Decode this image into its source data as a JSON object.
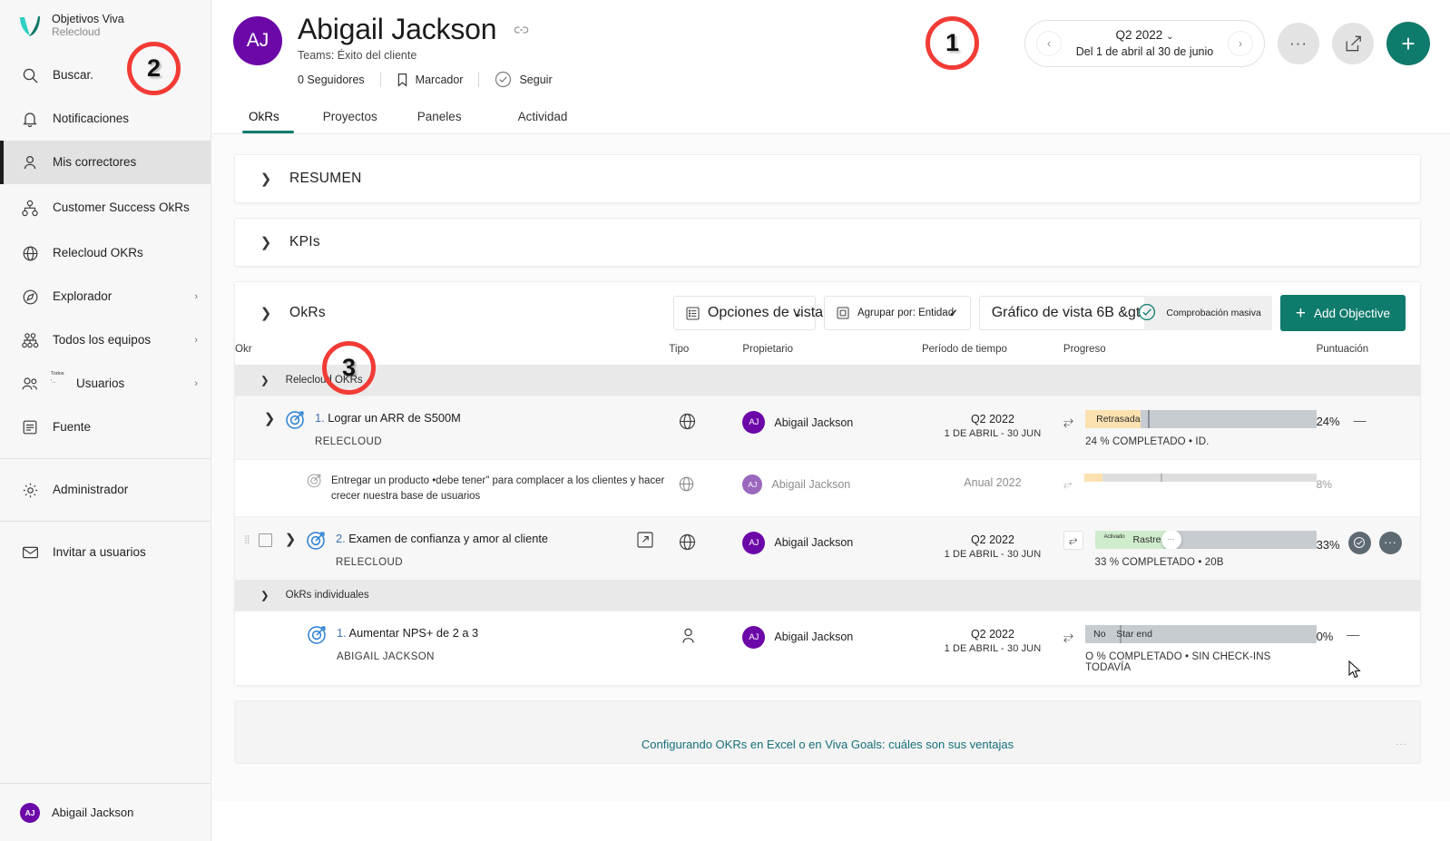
{
  "sidebar": {
    "brand": {
      "title": "Objetivos Viva",
      "subtitle": "Relecloud"
    },
    "items": [
      {
        "label": "Buscar.",
        "icon": "search-icon",
        "chevron": ""
      },
      {
        "label": "Notificaciones",
        "icon": "bell-icon",
        "chevron": ""
      },
      {
        "label": "Mis correctores",
        "icon": "person-icon",
        "chevron": ""
      },
      {
        "label": "Customer Success OkRs",
        "icon": "org-tree-icon",
        "chevron": ""
      },
      {
        "label": "Relecloud OKRs",
        "icon": "globe-icon",
        "chevron": ""
      },
      {
        "label": "Explorador",
        "icon": "compass-icon",
        "chevron": "›"
      },
      {
        "label": "Todos los equipos",
        "icon": "teams-tree-icon",
        "chevron": "›"
      },
      {
        "label": "Usuarios",
        "icon": "users-icon",
        "chevron": "›",
        "overlay": "Todos"
      },
      {
        "label": "Fuente",
        "icon": "feed-icon",
        "chevron": ""
      },
      {
        "label": "Administrador",
        "icon": "gear-icon",
        "chevron": ""
      },
      {
        "label": "Invitar a usuarios",
        "icon": "mail-icon",
        "chevron": ""
      }
    ],
    "footer_user": {
      "name": "Abigail Jackson",
      "initials": "AJ"
    }
  },
  "header": {
    "avatar_initials": "AJ",
    "title": "Abigail Jackson",
    "teams": "Teams: Éxito del cliente",
    "followers": "0 Seguidores",
    "bookmark": "Marcador",
    "follow": "Seguir"
  },
  "period": {
    "label": "Q2 2022",
    "range": "Del 1 de abril al 30 de junio",
    "prev": "‹",
    "next": "›"
  },
  "tabs": [
    {
      "label": "OkRs",
      "active": true
    },
    {
      "label": "Proyectos",
      "active": false
    },
    {
      "label": "Paneles",
      "active": false
    },
    {
      "label": "Actividad",
      "active": false
    }
  ],
  "panels": {
    "resumen": "RESUMEN",
    "kpis": "KPIs",
    "okrs": "OkRs"
  },
  "toolbar": {
    "view_options": "Opciones de vista",
    "group_by": "Agrupar por: Entidad",
    "chart_view": "Gráfico de vista 6B &gt",
    "mass_check": "Comprobación masiva",
    "add_objective": "Add Objective"
  },
  "table": {
    "headers": {
      "okr": "Okr",
      "tipo": "Tipo",
      "propietario": "Propietario",
      "periodo": "Período de tiempo",
      "progreso": "Progreso",
      "puntuacion": "Puntuación"
    },
    "groups": [
      {
        "name": "Relecloud OKRs",
        "rows": [
          {
            "kind": "objective",
            "number": "1.",
            "title": "Lograr un ARR de S500M",
            "subtitle": "RELECLOUD",
            "type_icon": "globe-icon",
            "owner": "Abigail Jackson",
            "owner_initials": "AJ",
            "period": "Q2 2022",
            "period_sub": "1 DE ABRIL - 30 JUN",
            "status_label": "Retrasada",
            "status_color": "#fbe2b0",
            "fill_pct": 24,
            "tick_pct": 27,
            "percent": "24%",
            "note": "24 % COMPLETADO • ID.",
            "score": "—",
            "actions": false
          },
          {
            "kind": "keyresult",
            "number": "",
            "title": "Entregar un producto •debe tener\" para complacer a los clientes y hacer crecer nuestra base de usuarios",
            "subtitle": "",
            "type_icon": "globe-icon",
            "owner": "Abigail Jackson",
            "owner_initials": "AJ",
            "period": "Anual 2022",
            "period_sub": "",
            "status_label": "",
            "status_color": "#fbe2b0",
            "fill_pct": 8,
            "tick_pct": 33,
            "percent": "8%",
            "note": "",
            "score": "",
            "actions": false
          },
          {
            "kind": "objective",
            "number": "2.",
            "title": "Examen de confianza y amor al cliente",
            "subtitle": "RELECLOUD",
            "type_icon": "globe-icon",
            "owner": "Abigail Jackson",
            "owner_initials": "AJ",
            "period": "Q2 2022",
            "period_sub": "1 DE ABRIL - 30 JUN",
            "status_label": "Rastrear",
            "status_mini": "Activado",
            "status_color": "#cfeccd",
            "fill_pct": 33,
            "tick_pct": 33,
            "percent": "33%",
            "note": "33 % COMPLETADO • 20B",
            "score": "",
            "actions": true,
            "selected": true,
            "has_open_link": true
          }
        ]
      },
      {
        "name": "OkRs individuales",
        "rows": [
          {
            "kind": "objective",
            "number": "1.",
            "title": "Aumentar NPS+ de 2 a 3",
            "subtitle": "ABIGAIL JACKSON",
            "type_icon": "person-icon",
            "owner": "Abigail Jackson",
            "owner_initials": "AJ",
            "period": "Q2 2022",
            "period_sub": "1 DE ABRIL - 30 JUN",
            "status_label": "No    Star end",
            "status_color": "#c7ccd1",
            "fill_pct": 0,
            "tick_pct": 15,
            "percent": "0%",
            "note": "O % COMPLETADO • SIN CHECK-INS TODAVÍA",
            "score": "—",
            "actions": false
          }
        ]
      }
    ]
  },
  "bottom": {
    "link": "Configurando OKRs en Excel o en Viva Goals: cuáles son sus ventajas"
  },
  "callouts": [
    {
      "id": 1,
      "number": "1"
    },
    {
      "id": 2,
      "number": "2"
    },
    {
      "id": 3,
      "number": "3"
    }
  ],
  "colors": {
    "accent": "#0f7b6c",
    "avatar": "#6c07a8",
    "callout": "#f23b35",
    "amber": "#fbe2b0",
    "green": "#cfeccd",
    "bar": "#c7ccd1"
  }
}
